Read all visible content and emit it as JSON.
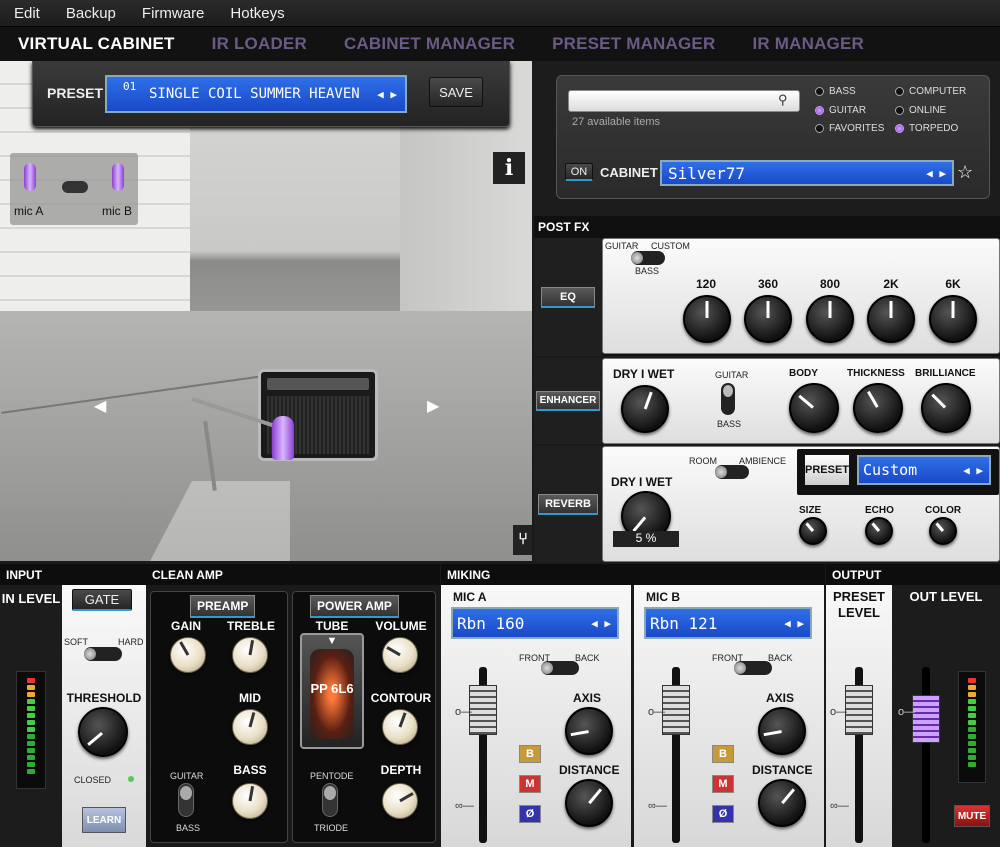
{
  "menu": [
    "Edit",
    "Backup",
    "Firmware",
    "Hotkeys"
  ],
  "tabs": [
    {
      "label": "VIRTUAL CABINET",
      "active": true
    },
    {
      "label": "IR LOADER",
      "active": false
    },
    {
      "label": "CABINET MANAGER",
      "active": false
    },
    {
      "label": "PRESET MANAGER",
      "active": false
    },
    {
      "label": "IR MANAGER",
      "active": false
    }
  ],
  "preset": {
    "label": "PRESET",
    "number": "01",
    "name": "SINGLE COIL SUMMER HEAVEN",
    "save": "SAVE"
  },
  "mics": {
    "a": "mic A",
    "b": "mic B"
  },
  "scene": {
    "info": "i"
  },
  "cabinet": {
    "search_value": "",
    "count": "27 available items",
    "filters": [
      {
        "label": "BASS",
        "on": false
      },
      {
        "label": "GUITAR",
        "on": true
      },
      {
        "label": "FAVORITES",
        "on": false
      },
      {
        "label": "COMPUTER",
        "on": false
      },
      {
        "label": "ONLINE",
        "on": false
      },
      {
        "label": "TORPEDO",
        "on": true
      }
    ],
    "on": "ON",
    "label": "CABINET",
    "value": "Silver77"
  },
  "postfx": {
    "title": "POST FX",
    "eq": {
      "button": "EQ",
      "mode_left": "GUITAR",
      "mode_right": "CUSTOM",
      "mode_bottom": "BASS",
      "bands": [
        "120",
        "360",
        "800",
        "2K",
        "6K"
      ]
    },
    "enhancer": {
      "button": "ENHANCER",
      "drywet": "DRY I WET",
      "guitar": "GUITAR",
      "bass": "BASS",
      "knobs": [
        "BODY",
        "THICKNESS",
        "BRILLIANCE"
      ]
    },
    "reverb": {
      "button": "REVERB",
      "drywet": "DRY I WET",
      "value": "5 %",
      "room": "ROOM",
      "ambience": "AMBIENCE",
      "preset_btn": "PRESET",
      "preset_value": "Custom",
      "knobs": [
        "SIZE",
        "ECHO",
        "COLOR"
      ]
    }
  },
  "input": {
    "title": "INPUT",
    "level": "IN LEVEL",
    "gate": "GATE",
    "soft": "SOFT",
    "hard": "HARD",
    "threshold": "THRESHOLD",
    "closed": "CLOSED",
    "learn": "LEARN"
  },
  "amp": {
    "title": "CLEAN AMP",
    "preamp": "PREAMP",
    "poweramp": "POWER AMP",
    "gain": "GAIN",
    "treble": "TREBLE",
    "mid": "MID",
    "bass": "BASS",
    "tube": "TUBE",
    "tube_value": "PP 6L6",
    "volume": "VOLUME",
    "contour": "CONTOUR",
    "depth": "DEPTH",
    "guitar": "GUITAR",
    "bass_sw": "BASS",
    "pentode": "PENTODE",
    "triode": "TRIODE"
  },
  "miking": {
    "title": "MIKING",
    "a": {
      "label": "MIC A",
      "value": "Rbn 160",
      "front": "FRONT",
      "back": "BACK",
      "axis": "AXIS",
      "distance": "DISTANCE"
    },
    "b": {
      "label": "MIC B",
      "value": "Rbn 121",
      "front": "FRONT",
      "back": "BACK",
      "axis": "AXIS",
      "distance": "DISTANCE"
    },
    "bm": [
      "B",
      "M",
      "Ø"
    ]
  },
  "output": {
    "title": "OUTPUT",
    "preset_level": "PRESET LEVEL",
    "out_level": "OUT LEVEL",
    "mute": "MUTE"
  },
  "colors": {
    "accent": "#2f6fe8",
    "purple": "#8a3fd1",
    "tab_inactive": "#6b5a86"
  }
}
